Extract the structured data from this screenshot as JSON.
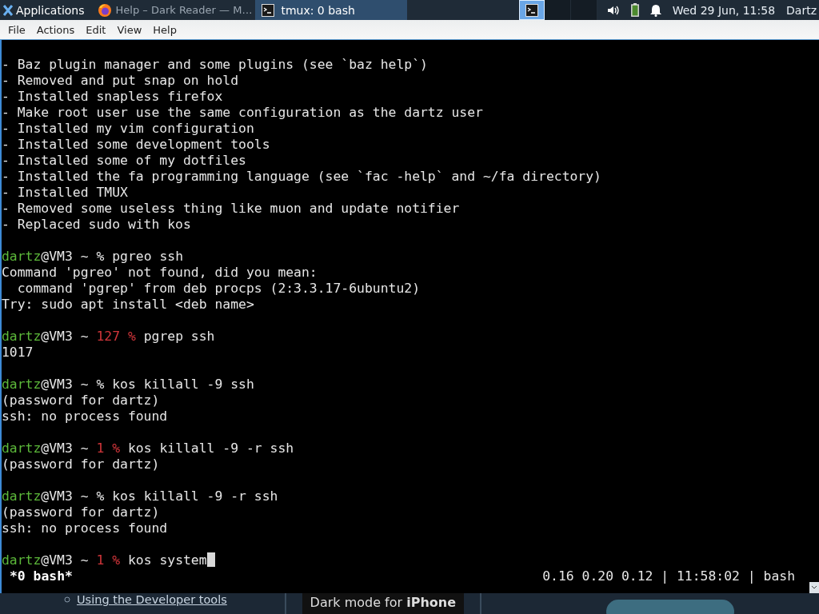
{
  "taskbar": {
    "apps_label": "Applications",
    "tasks": [
      {
        "title": "Help – Dark Reader — M…",
        "selected": false
      },
      {
        "title": "tmux: 0 bash",
        "selected": true
      }
    ],
    "workspaces": [
      {
        "selected": true
      },
      {
        "selected": false
      },
      {
        "selected": false
      }
    ],
    "clock": "Wed 29 Jun, 11:58",
    "user": "Dartz"
  },
  "menu": [
    "File",
    "Actions",
    "Edit",
    "View",
    "Help"
  ],
  "terminal": {
    "lines": [
      {
        "kind": "text",
        "text": "- Baz plugin manager and some plugins (see `baz help`)"
      },
      {
        "kind": "text",
        "text": "- Removed and put snap on hold"
      },
      {
        "kind": "text",
        "text": "- Installed snapless firefox"
      },
      {
        "kind": "text",
        "text": "- Make root user use the same configuration as the dartz user"
      },
      {
        "kind": "text",
        "text": "- Installed my vim configuration"
      },
      {
        "kind": "text",
        "text": "- Installed some development tools"
      },
      {
        "kind": "text",
        "text": "- Installed some of my dotfiles"
      },
      {
        "kind": "text",
        "text": "- Installed the fa programming language (see `fac -help` and ~/fa directory)"
      },
      {
        "kind": "text",
        "text": "- Installed TMUX"
      },
      {
        "kind": "text",
        "text": "- Removed some useless thing like muon and update notifier"
      },
      {
        "kind": "text",
        "text": "- Replaced sudo with kos"
      },
      {
        "kind": "blank"
      },
      {
        "kind": "prompt",
        "user": "dartz",
        "host": "@VM3 ~",
        "symbol": "%",
        "command": "pgreo ssh"
      },
      {
        "kind": "text",
        "text": "Command 'pgreo' not found, did you mean:"
      },
      {
        "kind": "text",
        "text": "  command 'pgrep' from deb procps (2:3.3.17-6ubuntu2)"
      },
      {
        "kind": "text",
        "text": "Try: sudo apt install <deb name>"
      },
      {
        "kind": "blank"
      },
      {
        "kind": "prompt",
        "user": "dartz",
        "host": "@VM3 ~",
        "status": "127 %",
        "command": "pgrep ssh"
      },
      {
        "kind": "text",
        "text": "1017"
      },
      {
        "kind": "blank"
      },
      {
        "kind": "prompt",
        "user": "dartz",
        "host": "@VM3 ~",
        "symbol": "%",
        "command": "kos killall -9 ssh"
      },
      {
        "kind": "text",
        "text": "(password for dartz)"
      },
      {
        "kind": "text",
        "text": "ssh: no process found"
      },
      {
        "kind": "blank"
      },
      {
        "kind": "prompt",
        "user": "dartz",
        "host": "@VM3 ~",
        "status": "1 %",
        "command": "kos killall -9 -r ssh"
      },
      {
        "kind": "text",
        "text": "(password for dartz)"
      },
      {
        "kind": "blank"
      },
      {
        "kind": "prompt",
        "user": "dartz",
        "host": "@VM3 ~",
        "symbol": "%",
        "command": "kos killall -9 -r ssh"
      },
      {
        "kind": "text",
        "text": "(password for dartz)"
      },
      {
        "kind": "text",
        "text": "ssh: no process found"
      },
      {
        "kind": "blank"
      },
      {
        "kind": "prompt",
        "user": "dartz",
        "host": "@VM3 ~",
        "status": "1 %",
        "command": "kos system",
        "cursor": true
      }
    ],
    "status_left": "*0 bash*",
    "status_right": "0.16 0.20 0.12 | 11:58:02 | bash"
  },
  "behind": {
    "link": "Using the Developer tools",
    "banner": "Dark mode for **iPhone**"
  }
}
